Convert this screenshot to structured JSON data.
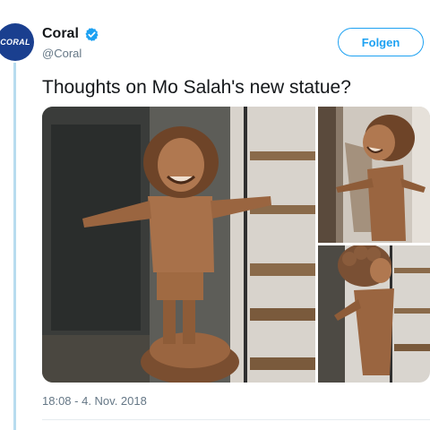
{
  "account": {
    "name": "Coral",
    "handle": "@Coral",
    "avatar_text": "CORAL",
    "verified": true
  },
  "follow_label": "Folgen",
  "tweet": {
    "text": "Thoughts on Mo Salah's new statue?",
    "timestamp": "18:08 - 4. Nov. 2018"
  },
  "colors": {
    "accent": "#1da1f2",
    "avatar_bg": "#1a3f8f",
    "thread_line": "#b8dcef",
    "secondary_text": "#657786"
  },
  "icons": {
    "verified": "verified-badge-icon"
  }
}
